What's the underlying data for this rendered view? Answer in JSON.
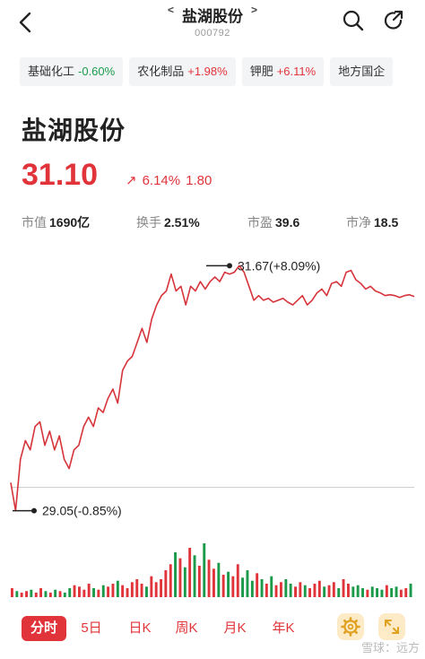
{
  "header": {
    "title": "盐湖股份",
    "code": "000792",
    "prev_glyph": "<",
    "next_glyph": ">",
    "icons": {
      "back": "back-arrow-icon",
      "search": "search-icon",
      "share": "share-icon"
    }
  },
  "sectors": [
    {
      "name": "基础化工",
      "pct": "-0.60%",
      "dir": "down"
    },
    {
      "name": "农化制品",
      "pct": "+1.98%",
      "dir": "up"
    },
    {
      "name": "钾肥",
      "pct": "+6.11%",
      "dir": "up"
    },
    {
      "name": "地方国企",
      "pct": "",
      "dir": "none"
    }
  ],
  "stock": {
    "name": "盐湖股份",
    "price": "31.10",
    "arrow": "↗",
    "pct": "6.14%",
    "change": "1.80"
  },
  "stats": [
    {
      "label": "市值",
      "value": "1690亿"
    },
    {
      "label": "换手",
      "value": "2.51%"
    },
    {
      "label": "市盈",
      "value": "39.6"
    },
    {
      "label": "市净",
      "value": "18.5"
    }
  ],
  "chart_data": {
    "type": "line",
    "series": [
      {
        "values": [
          29.35,
          29.05,
          29.6,
          29.8,
          29.7,
          29.95,
          30.0,
          29.75,
          29.9,
          29.7,
          29.85,
          29.6,
          29.5,
          29.7,
          29.75,
          29.95,
          30.05,
          29.95,
          30.15,
          30.1,
          30.25,
          30.35,
          30.2,
          30.55,
          30.65,
          30.7,
          30.85,
          31.0,
          30.85,
          31.1,
          31.25,
          31.35,
          31.4,
          31.58,
          31.4,
          31.45,
          31.25,
          31.45,
          31.4,
          31.5,
          31.42,
          31.5,
          31.55,
          31.5,
          31.6,
          31.58,
          31.6,
          31.67,
          31.6,
          31.45,
          31.3,
          31.35,
          31.3,
          31.32,
          31.28,
          31.3,
          31.32,
          31.28,
          31.25,
          31.3,
          31.35,
          31.25,
          31.3,
          31.38,
          31.42,
          31.35,
          31.48,
          31.5,
          31.45,
          31.6,
          31.62,
          31.52,
          31.48,
          31.42,
          31.45,
          31.4,
          31.38,
          31.35,
          31.36,
          31.35,
          31.33,
          31.35,
          31.36,
          31.34
        ]
      }
    ],
    "ylim": [
      28.95,
      31.75
    ],
    "annotations": [
      {
        "value": 31.67,
        "label": "31.67(+8.09%)",
        "kind": "high"
      },
      {
        "value": 29.05,
        "label": "29.05(-0.85%)",
        "kind": "low"
      }
    ],
    "reference_line": 29.3,
    "volume": [
      6,
      4,
      3,
      4,
      5,
      3,
      6,
      4,
      3,
      5,
      4,
      3,
      6,
      8,
      7,
      5,
      9,
      6,
      5,
      8,
      7,
      9,
      11,
      8,
      6,
      10,
      12,
      9,
      7,
      14,
      10,
      12,
      18,
      22,
      30,
      26,
      20,
      33,
      28,
      21,
      36,
      25,
      19,
      23,
      15,
      17,
      14,
      22,
      13,
      18,
      11,
      16,
      12,
      9,
      14,
      8,
      10,
      12,
      9,
      7,
      10,
      8,
      6,
      9,
      11,
      7,
      8,
      10,
      6,
      12,
      9,
      7,
      8,
      6,
      5,
      7,
      6,
      5,
      8,
      6,
      7,
      5,
      6,
      9
    ],
    "volume_colors": {
      "up": "#e0343a",
      "down": "#1a9a4a"
    }
  },
  "bottom_tabs": [
    "分时",
    "5日",
    "日K",
    "周K",
    "月K",
    "年K"
  ],
  "active_tab": 0,
  "tool_buttons": [
    "settings-gear-icon",
    "expand-arrows-icon"
  ],
  "watermark": "雪球：远方",
  "colors": {
    "up": "#e0343a",
    "down": "#1a9a4a",
    "line": "#d6343b",
    "accent_bg": "#fdebc8"
  }
}
